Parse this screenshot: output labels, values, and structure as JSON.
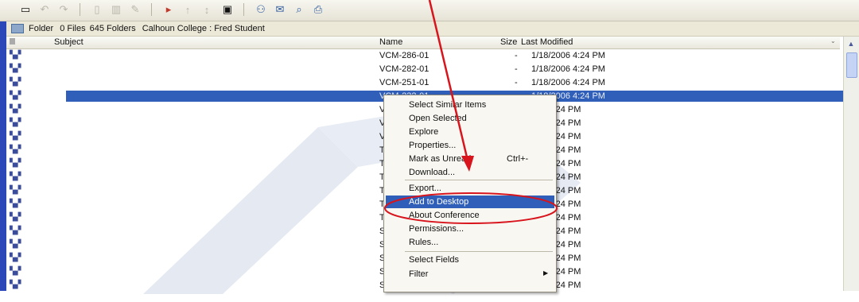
{
  "toolbar": {
    "icons": [
      "folder-nav-icon",
      "back-icon",
      "forward-icon",
      "cut-icon",
      "copy-icon",
      "paste-icon",
      "flag-icon",
      "sort-up-icon",
      "sort-down-icon",
      "folder-view-icon",
      "users-icon",
      "send-icon",
      "search-icon",
      "print-icon"
    ]
  },
  "path_bar": {
    "folder_label": "Folder",
    "files_count": "0 Files",
    "folders_count": "645 Folders",
    "location": "Calhoun College : Fred Student"
  },
  "columns": {
    "subject": "Subject",
    "name": "Name",
    "size": "Size",
    "last_modified": "Last Modified"
  },
  "rows": [
    {
      "name": "VCM-286-01",
      "size": "-",
      "modified": "1/18/2006  4:24 PM"
    },
    {
      "name": "VCM-282-01",
      "size": "-",
      "modified": "1/18/2006  4:24 PM"
    },
    {
      "name": "VCM-251-01",
      "size": "-",
      "modified": "1/18/2006  4:24 PM"
    },
    {
      "name": "VCM-232-01",
      "size": "",
      "modified": "1/18/2006  4:24 PM",
      "selected": true
    },
    {
      "name": "V",
      "size": "",
      "modified": "006  4:24 PM"
    },
    {
      "name": "V",
      "size": "",
      "modified": "006  4:24 PM"
    },
    {
      "name": "V",
      "size": "",
      "modified": "006  4:24 PM"
    },
    {
      "name": "Th",
      "size": "",
      "modified": "006  4:24 PM"
    },
    {
      "name": "Th",
      "size": "",
      "modified": "006  4:24 PM"
    },
    {
      "name": "Th",
      "size": "",
      "modified": "006  4:24 PM"
    },
    {
      "name": "Th",
      "size": "",
      "modified": "006  4:24 PM"
    },
    {
      "name": "Th",
      "size": "",
      "modified": "006  4:24 PM"
    },
    {
      "name": "Th",
      "size": "",
      "modified": "006  4:24 PM"
    },
    {
      "name": "St",
      "size": "",
      "modified": "006  4:24 PM"
    },
    {
      "name": "St",
      "size": "",
      "modified": "006  4:24 PM"
    },
    {
      "name": "Sf",
      "size": "",
      "modified": "006  4:24 PM"
    },
    {
      "name": "Sf",
      "size": "",
      "modified": "006  4:24 PM"
    },
    {
      "name": "Sf",
      "size": "",
      "modified": "006  4:24 PM"
    }
  ],
  "context_menu": {
    "items": [
      {
        "label": "Select Similar Items"
      },
      {
        "label": "Open Selected"
      },
      {
        "label": "Explore"
      },
      {
        "label": "Properties..."
      },
      {
        "label": "Mark as Unread",
        "shortcut": "Ctrl+-"
      },
      {
        "label": "Download..."
      },
      {
        "label": "Export..."
      },
      {
        "label": "Add to Desktop",
        "highlighted": true
      },
      {
        "label": "About Conference"
      },
      {
        "label": "Permissions..."
      },
      {
        "label": "Rules..."
      },
      {
        "label": "Select Fields"
      },
      {
        "label": "Filter",
        "submenu": true
      }
    ]
  },
  "colors": {
    "selection": "#2f5fb8",
    "annotation": "#d8141c",
    "left_strip": "#2c48b8"
  }
}
